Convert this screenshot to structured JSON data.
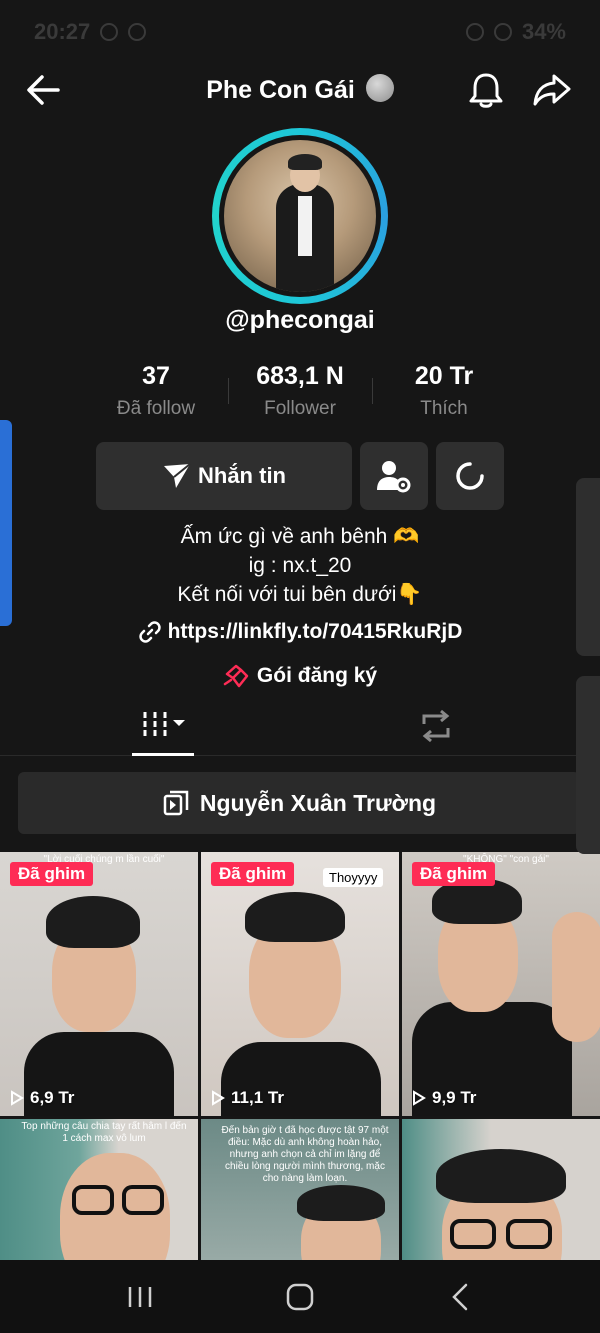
{
  "status_bar": {
    "time": "20:27",
    "battery": "34%"
  },
  "header": {
    "title": "Phe Con Gái"
  },
  "profile": {
    "username": "@phecongai",
    "stats": [
      {
        "value": "37",
        "label": "Đã follow"
      },
      {
        "value": "683,1 N",
        "label": "Follower"
      },
      {
        "value": "20 Tr",
        "label": "Thích"
      }
    ],
    "message_label": "Nhắn tin",
    "bio": [
      "Ấm ức gì về anh bênh 🫶",
      "ig : nx.t_20",
      "Kết nối với tui bên dưới👇"
    ],
    "link": "https://linkfly.to/70415RkuRjD",
    "subscription_label": "Gói đăng ký"
  },
  "playlist": {
    "label": "Nguyễn Xuân Trường"
  },
  "videos": [
    {
      "pinned": "Đã ghim",
      "views": "6,9 Tr",
      "caption": "\"Lời cuối chúng m lần cuối\""
    },
    {
      "pinned": "Đã ghim",
      "views": "11,1 Tr",
      "tag": "Thoyyyy"
    },
    {
      "pinned": "Đã ghim",
      "views": "9,9 Tr",
      "caption": "\"KHÔNG\" \"con gái\""
    },
    {
      "caption": "Top những câu chia tay rất hâm l đến 1 cách max vô lum"
    },
    {
      "caption": "Đến bản giờ t đã học được tật 97 một điều: Mặc dù anh không hoàn hảo, nhưng anh chọn cả chỉ im lặng để chiều lòng người mình thương, mặc cho nàng làm loạn."
    },
    {}
  ],
  "icons": {
    "back": "arrow-left-icon",
    "bell": "bell-icon",
    "share": "share-icon",
    "send": "send-icon",
    "add_friend": "add-friend-icon",
    "refresh": "refresh-icon",
    "link": "link-icon",
    "subscription": "gift-icon",
    "play": "play-icon"
  },
  "colors": {
    "accent": "#fe2c55",
    "ring": "#1ec7d8",
    "background": "#161616"
  }
}
